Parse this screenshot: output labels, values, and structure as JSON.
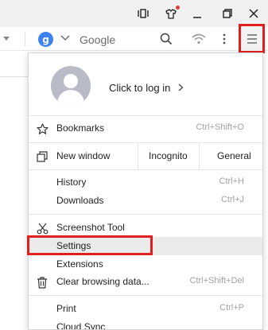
{
  "window": {
    "controls": [
      {
        "name": "media-icon"
      },
      {
        "name": "skin-icon"
      },
      {
        "name": "minimize-icon"
      },
      {
        "name": "restore-icon"
      },
      {
        "name": "close-icon"
      }
    ]
  },
  "toolbar": {
    "search_engine_initial": "g",
    "search_engine_name": "Google",
    "engine_color": "#3d82f0"
  },
  "menu": {
    "profile": {
      "login_text": "Click to log in"
    },
    "items": [
      {
        "label": "Bookmarks",
        "shortcut": "Ctrl+Shift+O",
        "icon": "star-icon"
      },
      {
        "label": "History",
        "shortcut": "Ctrl+H"
      },
      {
        "label": "Downloads",
        "shortcut": "Ctrl+J"
      },
      {
        "label": "Screenshot Tool",
        "shortcut": "",
        "icon": "scissors-icon"
      },
      {
        "label": "Settings",
        "shortcut": ""
      },
      {
        "label": "Extensions",
        "shortcut": ""
      },
      {
        "label": "Clear browsing data...",
        "shortcut": "Ctrl+Shift+Del",
        "icon": "trash-icon"
      },
      {
        "label": "Print",
        "shortcut": "Ctrl+P"
      },
      {
        "label": "Cloud Sync",
        "shortcut": ""
      }
    ],
    "window_row": {
      "new_window": "New window",
      "incognito": "Incognito",
      "general": "General"
    }
  },
  "highlight_color": "#e02020"
}
